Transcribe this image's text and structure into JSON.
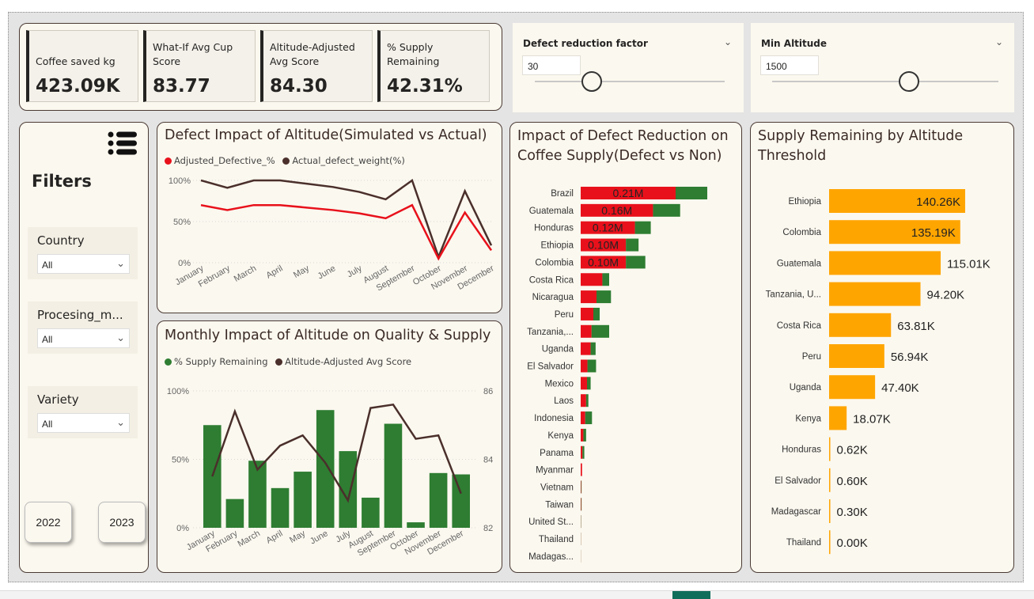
{
  "kpis": [
    {
      "label": "Coffee saved kg",
      "value": "423.09K"
    },
    {
      "label": "What-If Avg Cup Score",
      "value": "83.77"
    },
    {
      "label": "Altitude-Adjusted Avg Score",
      "value": "84.30"
    },
    {
      "label": "% Supply Remaining",
      "value": "42.31%"
    }
  ],
  "slicers": {
    "defect": {
      "title": "Defect reduction factor",
      "value": "30"
    },
    "altitude": {
      "title": "Min Altitude",
      "value": "1500"
    }
  },
  "filters": {
    "title": "Filters",
    "country": {
      "label": "Country",
      "value": "All"
    },
    "processing": {
      "label": "Procesing_m...",
      "value": "All"
    },
    "variety": {
      "label": "Variety",
      "value": "All"
    },
    "years": [
      "2022",
      "2023"
    ]
  },
  "colors": {
    "red": "#e8111b",
    "green": "#2e7d32",
    "dark": "#4a2f2b",
    "orange": "#ffa500"
  },
  "chart_data": [
    {
      "type": "line",
      "title": "Defect Impact of Altitude(Simulated vs Actual)",
      "categories": [
        "January",
        "February",
        "March",
        "April",
        "May",
        "June",
        "July",
        "August",
        "September",
        "October",
        "November",
        "December"
      ],
      "yticks": [
        "100%",
        "50%",
        "0%"
      ],
      "ylim": [
        0,
        100
      ],
      "series": [
        {
          "name": "Adjusted_Defective_%",
          "color": "#e8111b",
          "values": [
            70,
            64,
            70,
            70,
            67,
            64,
            60,
            54,
            70,
            5,
            61,
            15
          ]
        },
        {
          "name": "Actual_defect_weight(%)",
          "color": "#4a2f2b",
          "values": [
            100,
            91,
            100,
            100,
            96,
            92,
            86,
            77,
            100,
            7,
            87,
            21
          ]
        }
      ]
    },
    {
      "type": "bar",
      "title": "Monthly Impact of Altitude on Quality & Supply",
      "categories": [
        "January",
        "February",
        "March",
        "April",
        "May",
        "June",
        "July",
        "August",
        "September",
        "October",
        "November",
        "December"
      ],
      "yticks_left": [
        "100%",
        "50%",
        "0%"
      ],
      "yticks_right": [
        "86",
        "84",
        "82"
      ],
      "ylim_left": [
        0,
        100
      ],
      "ylim_right": [
        82,
        86
      ],
      "series": [
        {
          "name": "% Supply Remaining",
          "color": "#2e7d32",
          "values": [
            75,
            21,
            49,
            29,
            41,
            86,
            56,
            22,
            76,
            4,
            40,
            39
          ]
        },
        {
          "name": "Altitude-Adjusted Avg Score",
          "color": "#4a2f2b",
          "values": [
            83.5,
            85.4,
            83.7,
            84.4,
            84.7,
            83.9,
            82.8,
            85.5,
            85.6,
            84.6,
            84.7,
            83.0
          ]
        }
      ]
    },
    {
      "type": "bar",
      "title": "Impact of Defect Reduction on Coffee Supply(Defect vs Non)",
      "categories": [
        "Brazil",
        "Guatemala",
        "Honduras",
        "Ethiopia",
        "Colombia",
        "Costa Rica",
        "Nicaragua",
        "Peru",
        "Tanzania,...",
        "Uganda",
        "El Salvador",
        "Mexico",
        "Laos",
        "Indonesia",
        "Kenya",
        "Panama",
        "Myanmar",
        "Vietnam",
        "Taiwan",
        "United St...",
        "Thailand",
        "Madagas..."
      ],
      "series": [
        {
          "name": "Defect",
          "color": "#e8111b",
          "values": [
            0.21,
            0.16,
            0.12,
            0.1,
            0.1,
            0.048,
            0.035,
            0.028,
            0.024,
            0.022,
            0.015,
            0.014,
            0.012,
            0.01,
            0.006,
            0.004,
            0.003,
            0.001,
            0.001,
            0.0005,
            0.0003,
            0.0002
          ]
        },
        {
          "name": "Non-defect",
          "color": "#2e7d32",
          "values": [
            0.07,
            0.06,
            0.035,
            0.028,
            0.043,
            0.015,
            0.032,
            0.014,
            0.039,
            0.011,
            0.019,
            0.008,
            0.005,
            0.015,
            0.006,
            0.004,
            0.0,
            0.001,
            0.001,
            0.0005,
            0.0003,
            0.0002
          ]
        }
      ],
      "data_labels": [
        "0.21M",
        "0.16M",
        "0.12M",
        "0.10M",
        "0.10M"
      ]
    },
    {
      "type": "bar",
      "title": "Supply Remaining by Altitude Threshold",
      "categories": [
        "Ethiopia",
        "Colombia",
        "Guatemala",
        "Tanzania, U...",
        "Costa Rica",
        "Peru",
        "Uganda",
        "Kenya",
        "Honduras",
        "El Salvador",
        "Madagascar",
        "Thailand"
      ],
      "values": [
        140.26,
        135.19,
        115.01,
        94.2,
        63.81,
        56.94,
        47.4,
        18.07,
        0.62,
        0.6,
        0.3,
        0.0
      ],
      "labels": [
        "140.26K",
        "135.19K",
        "115.01K",
        "94.20K",
        "63.81K",
        "56.94K",
        "47.40K",
        "18.07K",
        "0.62K",
        "0.60K",
        "0.30K",
        "0.00K"
      ],
      "color": "#ffa500"
    }
  ]
}
